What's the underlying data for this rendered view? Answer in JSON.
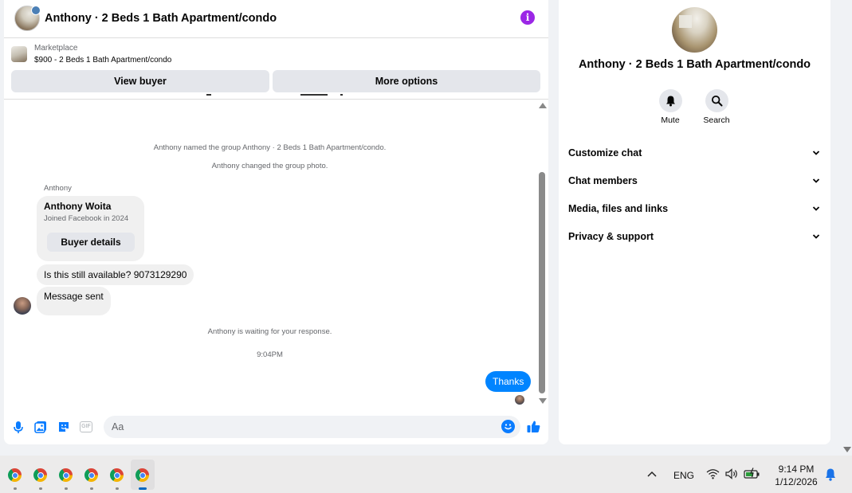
{
  "header": {
    "title": "Anthony · 2 Beds 1 Bath Apartment/condo",
    "info_icon": "i"
  },
  "marketplace": {
    "label": "Marketplace",
    "listing": "$900 - 2 Beds 1 Bath Apartment/condo",
    "view_buyer": "View buyer",
    "more_options": "More options"
  },
  "messages": {
    "system_named": "Anthony named the group Anthony · 2 Beds 1 Bath Apartment/condo.",
    "system_photo": "Anthony changed the group photo.",
    "sender": "Anthony",
    "card_name": "Anthony Woita",
    "card_sub": "Joined Facebook in 2024",
    "card_button": "Buyer details",
    "incoming_1": "Is this still available? 9073129290",
    "incoming_2": "Message sent",
    "waiting": "Anthony is waiting for your response.",
    "time": "9:04PM",
    "outgoing_1": "Thanks"
  },
  "composer": {
    "placeholder": "Aa",
    "gif_label": "GIF"
  },
  "info": {
    "title": "Anthony · 2 Beds 1 Bath Apartment/condo",
    "actions": {
      "mute": "Mute",
      "search": "Search"
    },
    "sections": [
      "Customize chat",
      "Chat members",
      "Media, files and links",
      "Privacy & support"
    ]
  },
  "taskbar": {
    "apps": [
      "Chrome",
      "Chrome",
      "Chrome",
      "Chrome",
      "Chrome",
      "Chrome"
    ],
    "language": "ENG",
    "time": "9:14 PM",
    "date": "1/12/2026"
  },
  "colors": {
    "accent": "#0084ff",
    "info_icon": "#9b27e6"
  }
}
